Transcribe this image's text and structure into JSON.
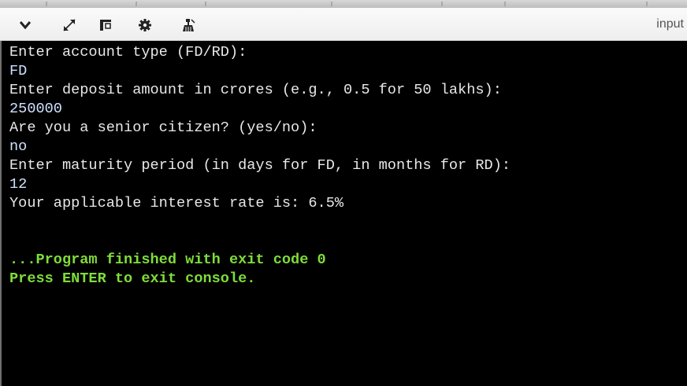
{
  "toolbar": {
    "buttons": [
      {
        "name": "collapse",
        "icon": "chevron-down-icon"
      },
      {
        "name": "expand",
        "icon": "expand-arrows-icon"
      },
      {
        "name": "layout",
        "icon": "panel-layout-icon"
      },
      {
        "name": "settings",
        "icon": "gear-icon"
      },
      {
        "name": "clean",
        "icon": "broom-icon"
      }
    ],
    "input_tab_label": "input"
  },
  "console": {
    "lines": [
      {
        "text": "Enter account type (FD/RD):",
        "kind": "output"
      },
      {
        "text": "FD",
        "kind": "input"
      },
      {
        "text": "Enter deposit amount in crores (e.g., 0.5 for 50 lakhs):",
        "kind": "output"
      },
      {
        "text": "250000",
        "kind": "input"
      },
      {
        "text": "Are you a senior citizen? (yes/no):",
        "kind": "output"
      },
      {
        "text": "no",
        "kind": "input"
      },
      {
        "text": "Enter maturity period (in days for FD, in months for RD):",
        "kind": "output"
      },
      {
        "text": "12",
        "kind": "input"
      },
      {
        "text": "Your applicable interest rate is: 6.5%",
        "kind": "output"
      }
    ],
    "finish_line": "...Program finished with exit code 0",
    "exit_hint": "Press ENTER to exit console."
  },
  "colors": {
    "console_bg": "#000000",
    "output_text": "#e8e8e8",
    "success_text": "#7fdc3a",
    "toolbar_bg": "#f3f3f3"
  }
}
